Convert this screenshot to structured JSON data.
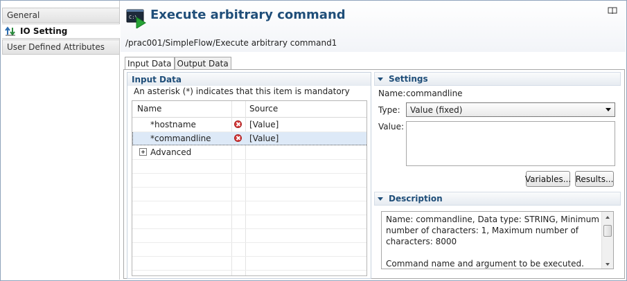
{
  "sidebar": {
    "items": [
      {
        "label": "General"
      },
      {
        "label": "IO Setting"
      },
      {
        "label": "User Defined Attributes"
      }
    ]
  },
  "header": {
    "title": "Execute arbitrary command",
    "path": "/prac001/SimpleFlow/Execute arbitrary command1",
    "icon": "command-prompt-icon"
  },
  "tabs": [
    {
      "label": "Input Data",
      "active": true
    },
    {
      "label": "Output Data",
      "active": false
    }
  ],
  "input_data": {
    "title": "Input Data",
    "note": "An asterisk (*) indicates that this item is mandatory",
    "columns": [
      "Name",
      "Source"
    ],
    "rows": [
      {
        "name": "*hostname",
        "source": "[Value]",
        "error": true
      },
      {
        "name": "*commandline",
        "source": "[Value]",
        "error": true,
        "selected": true
      },
      {
        "name": "Advanced",
        "source": "",
        "expander": true
      }
    ]
  },
  "settings": {
    "title": "Settings",
    "name_label": "Name:",
    "name_value": "commandline",
    "type_label": "Type:",
    "type_value": "Value (fixed)",
    "value_label": "Value:",
    "value_text": "",
    "variables_button": "Variables...",
    "results_button": "Results..."
  },
  "description": {
    "title": "Description",
    "text1": "Name: commandline, Data type: STRING, Minimum number of characters: 1, Maximum number of characters: 8000",
    "text2": "Command name and argument to be executed."
  },
  "colors": {
    "title_blue": "#1f4e79",
    "error_red": "#d93a3a",
    "selection": "#dde9f7"
  }
}
